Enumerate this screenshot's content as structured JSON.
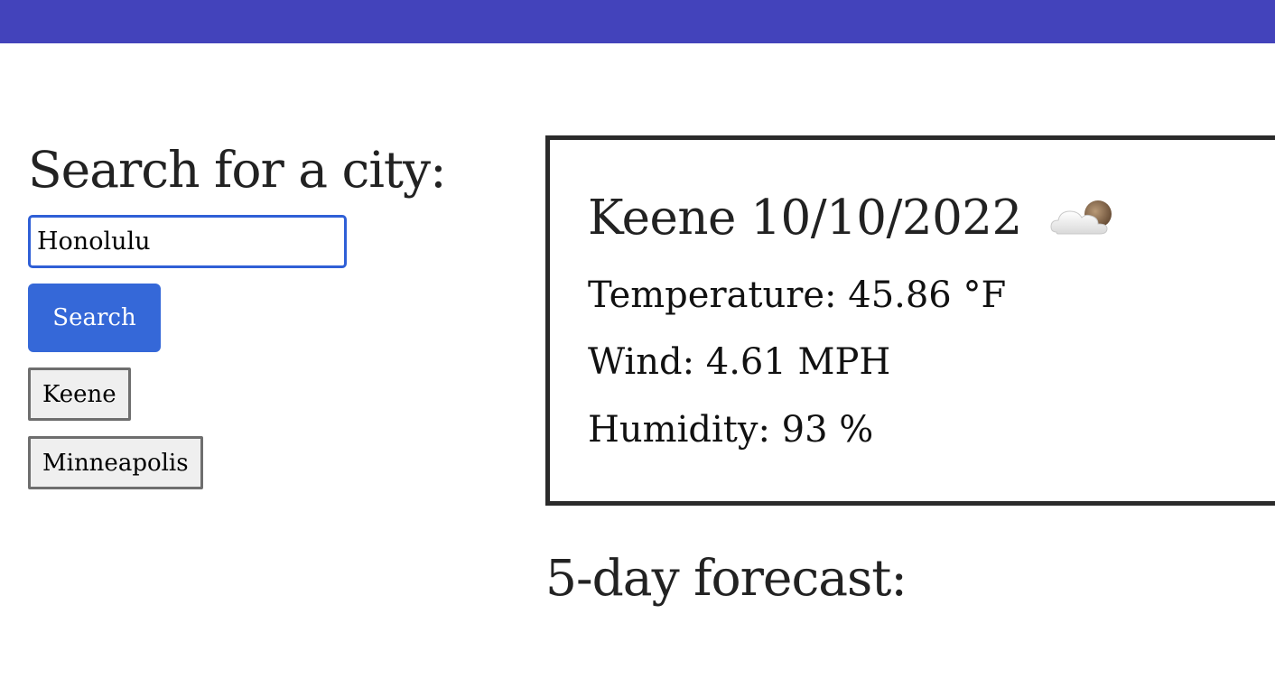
{
  "colors": {
    "topbar": "#4343bb",
    "search_button": "#3568d8",
    "input_border": "#2f5fd6",
    "card_border": "#2b2b2b"
  },
  "sidebar": {
    "heading": "Search for a city:",
    "search_input_value": "Honolulu",
    "search_button_label": "Search",
    "history": [
      {
        "label": "Keene"
      },
      {
        "label": "Minneapolis"
      }
    ]
  },
  "current": {
    "city": "Keene",
    "date": "10/10/2022",
    "icon": "partly-cloudy-night-icon",
    "temperature": "Temperature: 45.86 °F",
    "wind": "Wind: 4.61 MPH",
    "humidity": "Humidity: 93 %"
  },
  "forecast": {
    "heading": "5-day forecast:"
  }
}
